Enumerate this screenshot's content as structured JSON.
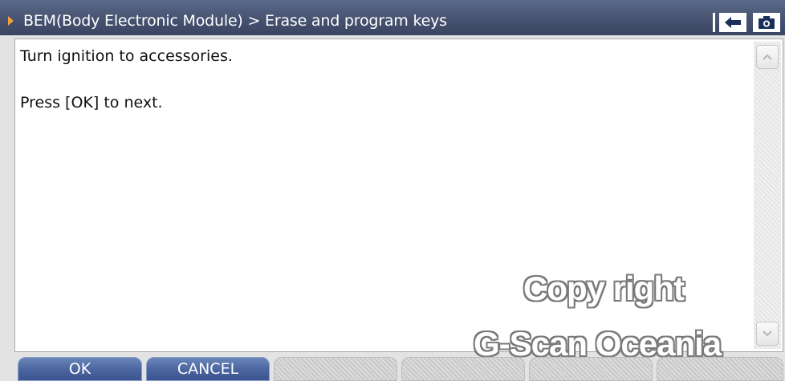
{
  "title_bar": {
    "breadcrumb": "BEM(Body Electronic Module) > Erase and program keys",
    "back_icon": "back-arrow-icon",
    "capture_icon": "camera-icon"
  },
  "content": {
    "lines": [
      "Turn ignition to accessories.",
      "Press [OK] to next."
    ]
  },
  "watermark": {
    "line1": "Copy right",
    "line2": "G-Scan Oceania"
  },
  "function_keys": [
    {
      "label": "OK",
      "state": "active"
    },
    {
      "label": "CANCEL",
      "state": "active"
    },
    {
      "label": "",
      "state": "empty"
    },
    {
      "label": "",
      "state": "empty"
    },
    {
      "label": "",
      "state": "empty"
    },
    {
      "label": "",
      "state": "empty"
    }
  ],
  "colors": {
    "titlebar": "#44506e",
    "accent_arrow": "#f2a23a",
    "button_active": "#4a64a0"
  }
}
